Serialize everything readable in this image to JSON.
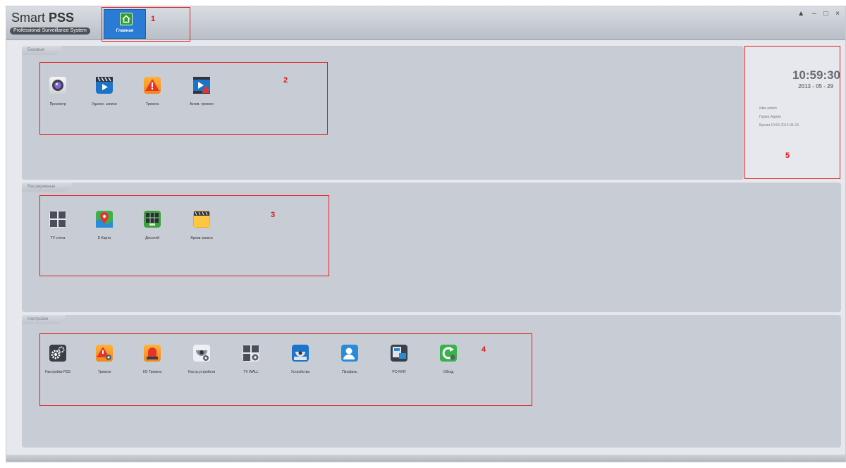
{
  "app": {
    "logo_main": "Smart",
    "logo_bold": "PSS",
    "logo_sub": "Professional Surveillance System",
    "home_tab": "Главная",
    "window_controls": [
      "▲",
      "–",
      "□",
      "×"
    ]
  },
  "sections": {
    "basic": {
      "title": "Базовые",
      "items": [
        {
          "label": "Просмотр",
          "icon": "camera-icon"
        },
        {
          "label": "Удален. записи",
          "icon": "clapperboard-playback-icon"
        },
        {
          "label": "Тревога",
          "icon": "alarm-warning-icon"
        },
        {
          "label": "Актив. тревоги",
          "icon": "video-alarm-icon"
        }
      ]
    },
    "extended": {
      "title": "Расширенные",
      "items": [
        {
          "label": "TV стена",
          "icon": "tv-wall-icon"
        },
        {
          "label": "E-Карта",
          "icon": "map-pin-icon"
        },
        {
          "label": "Дисплей",
          "icon": "display-grid-icon"
        },
        {
          "label": "Архив записи",
          "icon": "archive-folder-icon"
        }
      ]
    },
    "settings": {
      "title": "Настройки",
      "items": [
        {
          "label": "Настройки PSS",
          "icon": "gears-icon"
        },
        {
          "label": "Тревога",
          "icon": "alarm-settings-icon"
        },
        {
          "label": "I/O Тревоги",
          "icon": "siren-icon"
        },
        {
          "label": "Настр.устройств",
          "icon": "dome-camera-settings-icon"
        },
        {
          "label": "TV WALL",
          "icon": "tv-wall-settings-icon"
        },
        {
          "label": "Устройства",
          "icon": "device-camera-icon"
        },
        {
          "label": "Профиль",
          "icon": "user-profile-icon"
        },
        {
          "label": "PC-NVR",
          "icon": "pc-nvr-icon"
        },
        {
          "label": "Обход",
          "icon": "tour-refresh-icon"
        }
      ]
    }
  },
  "clock": {
    "time": "10:59:30",
    "date": "2013 - 05 - 29",
    "user_line": "Имя    admin",
    "rights_line": "Права Админ",
    "login_time_line": "Время 10:59 2013-05-29"
  },
  "annotations": [
    "1",
    "2",
    "3",
    "4",
    "5"
  ],
  "colors": {
    "accent": "#2a7bd3",
    "panel": "#c8ccd5",
    "annotation": "#e02020"
  }
}
